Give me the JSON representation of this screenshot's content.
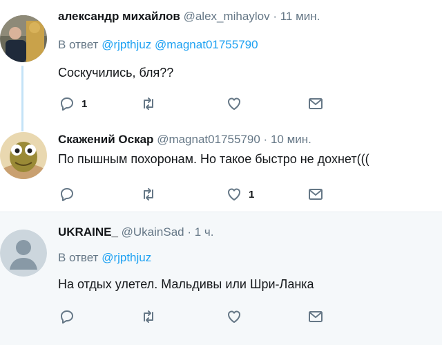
{
  "tweets": [
    {
      "name": "александр михайлов",
      "handle": "@alex_mihaylov",
      "dot": "·",
      "time": "11 мин.",
      "reply_prefix": "В ответ",
      "mentions": [
        "@rjpthjuz",
        "@magnat01755790"
      ],
      "text": "Соскучились, бля??",
      "reply_count": "1",
      "like_count": ""
    },
    {
      "name": "Скажений Оскар",
      "handle": "@magnat01755790",
      "dot": "·",
      "time": "10 мин.",
      "text": "По пышным похоронам. Но такое быстро не дохнет(((",
      "reply_count": "",
      "like_count": "1"
    },
    {
      "name": "UKRAINE_",
      "handle": "@UkainSad",
      "dot": "·",
      "time": "1 ч.",
      "reply_prefix": "В ответ",
      "mentions": [
        "@rjpthjuz"
      ],
      "text": "На отдых улетел. Мальдивы или Шри-Ланка",
      "reply_count": "",
      "like_count": ""
    }
  ],
  "icons": {
    "reply": "reply-icon",
    "retweet": "retweet-icon",
    "like": "like-icon",
    "message": "direct-message-icon"
  },
  "colors": {
    "link": "#1da1f2",
    "muted": "#657786",
    "thread_line": "#c4e3f7",
    "highlight_bg": "#f5f8fa"
  }
}
